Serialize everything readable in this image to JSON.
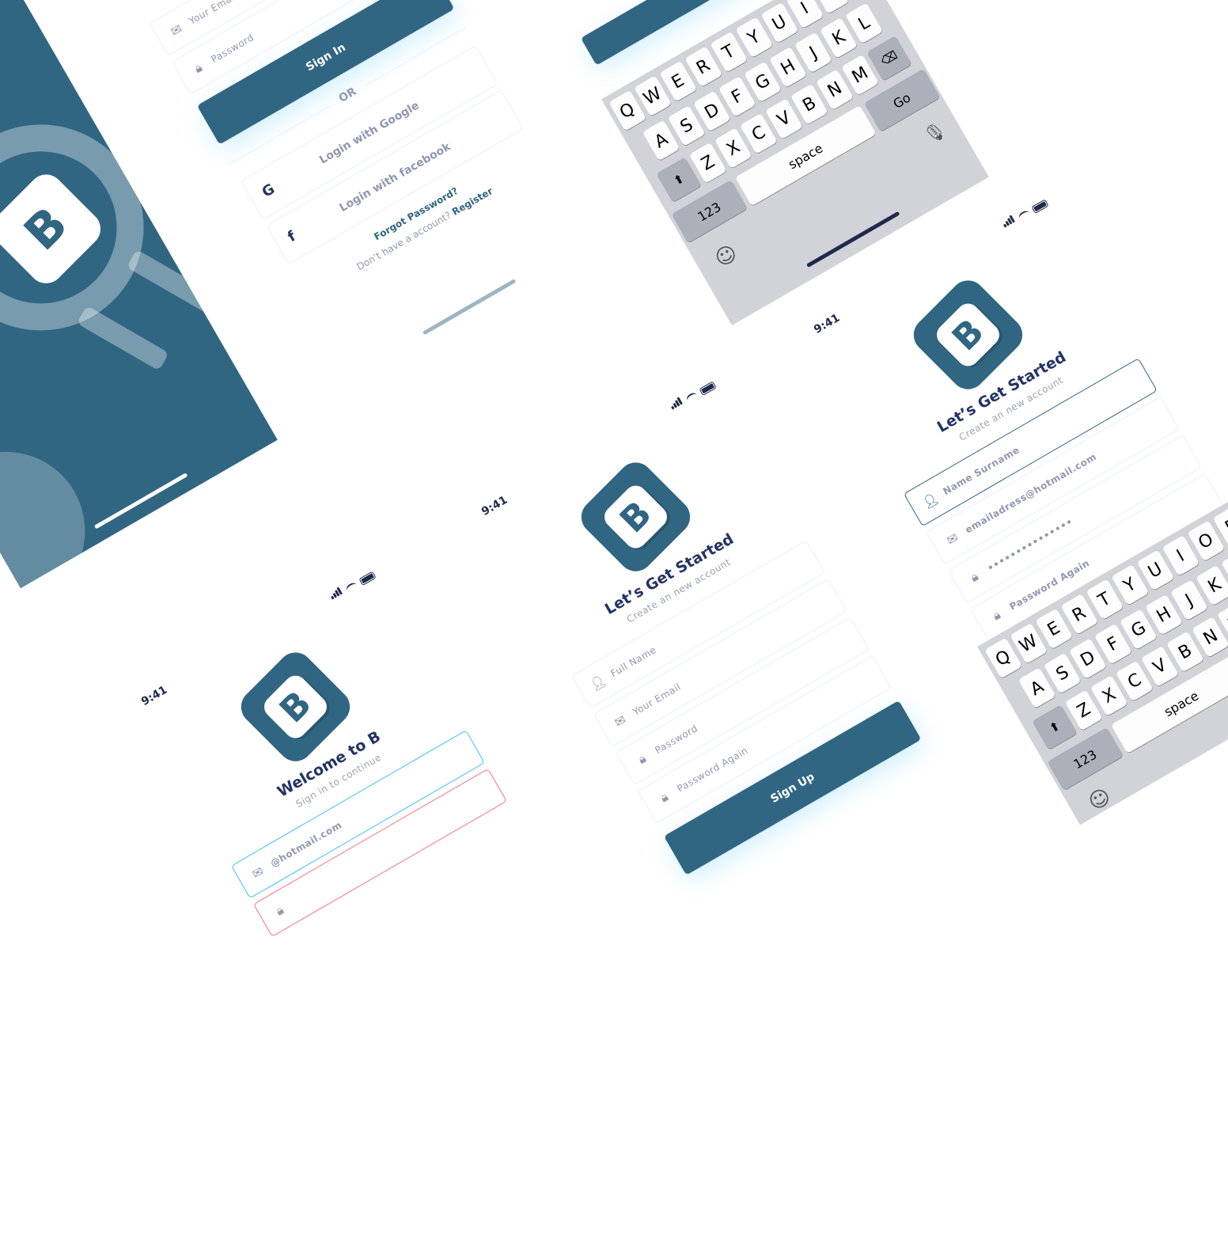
{
  "status": {
    "time": "9:41"
  },
  "splash": {
    "logo_letter": "B"
  },
  "login": {
    "title": "Welcome to B",
    "subtitle": "Sign in to continue",
    "email_placeholder": "Your Email",
    "password_placeholder": "Password",
    "email_value": "@hotmail.com",
    "sign_in": "Sign In",
    "or": "OR",
    "google": "Login with Google",
    "facebook": "Login with facebook",
    "forgot": "Forgot Password?",
    "no_account": "Don’t have a account?",
    "register": "Register",
    "logo_letter": "B"
  },
  "register": {
    "title": "Let’s Get Started",
    "subtitle": "Create an new account",
    "full_name": "Full Name",
    "email": "Your Email",
    "password": "Password",
    "password_again": "Password Again",
    "sign_up": "Sign Up",
    "logo_letter": "B"
  },
  "register_filled": {
    "title": "Let’s Get Started",
    "subtitle": "Create an new account",
    "name_value": "Name Surname",
    "email_value": "emailadress@hotmail.com",
    "password_value": "•••••••••••••••",
    "password_again": "Password Again",
    "logo_letter": "B"
  },
  "keyboard": {
    "row1": [
      "Q",
      "W",
      "E",
      "R",
      "T",
      "Y",
      "U",
      "I",
      "O",
      "P"
    ],
    "row2": [
      "A",
      "S",
      "D",
      "F",
      "G",
      "H",
      "J",
      "K",
      "L"
    ],
    "row3": [
      "Z",
      "X",
      "C",
      "V",
      "B",
      "N",
      "M"
    ],
    "numbers": "123",
    "space": "space",
    "go": "Go"
  },
  "colors": {
    "brand": "#316682",
    "accent_blue": "#40bfff",
    "error_red": "#fb7181"
  }
}
